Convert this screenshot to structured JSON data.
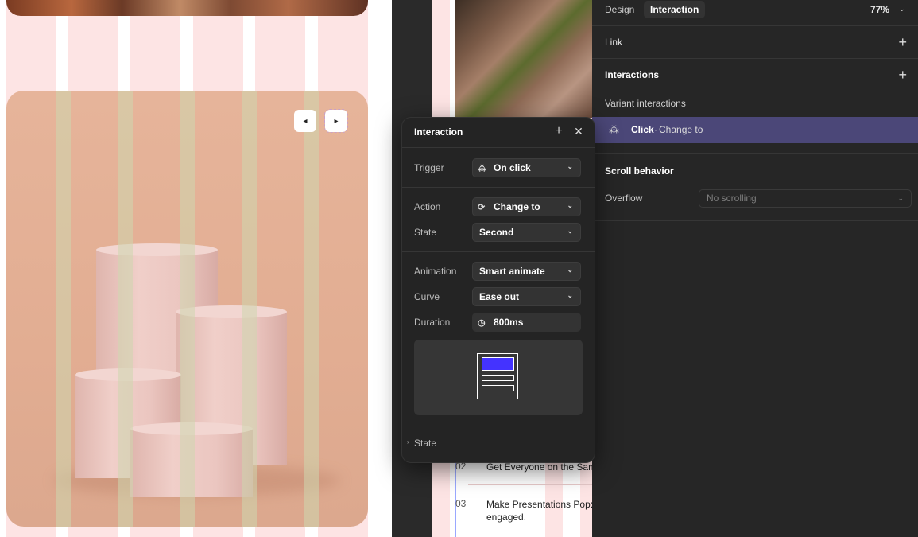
{
  "carousel": {
    "prev_icon": "◂",
    "next_icon": "▸"
  },
  "mid_list": [
    {
      "num": "02",
      "text": "Get Everyone on the Sam"
    },
    {
      "num": "03",
      "text": "Make Presentations Pop:",
      "text2": "engaged."
    }
  ],
  "popup": {
    "title": "Interaction",
    "fields": {
      "trigger": {
        "label": "Trigger",
        "value": "On click",
        "icon": "tap-icon"
      },
      "action": {
        "label": "Action",
        "value": "Change to",
        "icon": "cycle-icon"
      },
      "state": {
        "label": "State",
        "value": "Second"
      },
      "animation": {
        "label": "Animation",
        "value": "Smart animate"
      },
      "curve": {
        "label": "Curve",
        "value": "Ease out"
      },
      "duration": {
        "label": "Duration",
        "value": "800ms",
        "icon": "timer-icon"
      }
    },
    "footer_section": "State"
  },
  "right_panel": {
    "tabs": [
      {
        "label": "Design",
        "active": false
      },
      {
        "label": "Interaction",
        "active": true
      }
    ],
    "zoom": "77%",
    "link_label": "Link",
    "interactions_title": "Interactions",
    "variant_interactions_label": "Variant interactions",
    "variant_item": {
      "trigger": "Click",
      "separator": "·",
      "action": "Change to"
    },
    "scroll_behavior_title": "Scroll behavior",
    "overflow_label": "Overflow",
    "overflow_value": "No scrolling"
  },
  "colors": {
    "accent_variant_row": "#4b4778",
    "preview_accent": "#4433ff",
    "panel_bg": "#262626",
    "grid_strip": "#fde4e4"
  }
}
